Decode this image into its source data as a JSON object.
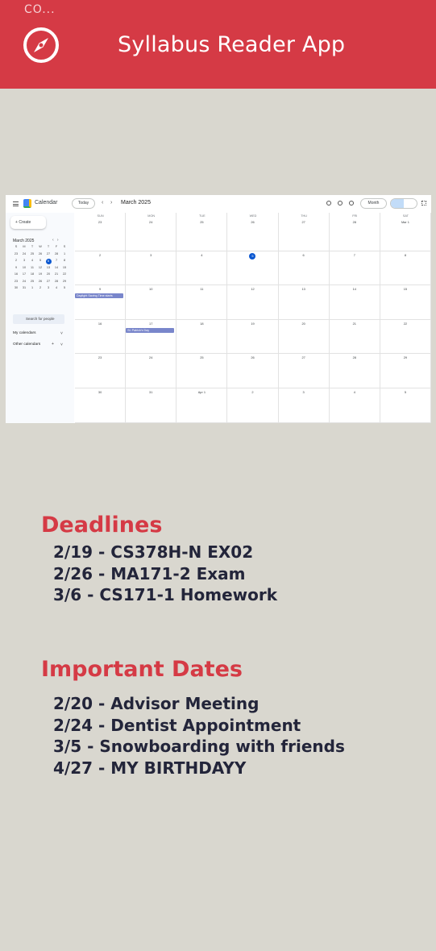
{
  "status_bar": {
    "text": "CO..."
  },
  "app_bar": {
    "title": "Syllabus Reader App",
    "icon": "compass-icon",
    "color": "#d53a45"
  },
  "calendar_screenshot": {
    "app_name": "Calendar",
    "today_button": "Today",
    "month_title": "March 2025",
    "view_select": "Month",
    "create_button": "Create",
    "mini_calendar": {
      "title": "March 2025",
      "weekday_letters": [
        "S",
        "M",
        "T",
        "W",
        "T",
        "F",
        "S"
      ],
      "days": [
        "23",
        "24",
        "25",
        "26",
        "27",
        "28",
        "1",
        "2",
        "3",
        "4",
        "5",
        "6",
        "7",
        "8",
        "9",
        "10",
        "11",
        "12",
        "13",
        "14",
        "15",
        "16",
        "17",
        "18",
        "19",
        "20",
        "21",
        "22",
        "23",
        "24",
        "25",
        "26",
        "27",
        "28",
        "29",
        "30",
        "31",
        "1",
        "2",
        "3",
        "4",
        "5"
      ],
      "selected": "5"
    },
    "search_people": "Search for people",
    "my_calendars": "My calendars",
    "other_calendars": "Other calendars",
    "weekdays": [
      "SUN",
      "MON",
      "TUE",
      "WED",
      "THU",
      "FRI",
      "SAT"
    ],
    "weeks": [
      [
        "23",
        "24",
        "25",
        "26",
        "27",
        "28",
        "Mar 1"
      ],
      [
        "2",
        "3",
        "4",
        "5",
        "6",
        "7",
        "8"
      ],
      [
        "9",
        "10",
        "11",
        "12",
        "13",
        "14",
        "15"
      ],
      [
        "16",
        "17",
        "18",
        "19",
        "20",
        "21",
        "22"
      ],
      [
        "23",
        "24",
        "25",
        "26",
        "27",
        "28",
        "29"
      ],
      [
        "30",
        "31",
        "Apr 1",
        "2",
        "3",
        "4",
        "5"
      ]
    ],
    "today_date": "5",
    "events": [
      {
        "title": "Daylight Saving Time starts",
        "week": 2,
        "day": 0
      },
      {
        "title": "St. Patrick's Day",
        "week": 3,
        "day": 1
      }
    ]
  },
  "deadlines": {
    "heading": "Deadlines",
    "items": [
      "2/19 - CS378H-N EX02",
      "2/26 - MA171-2 Exam",
      "3/6 - CS171-1 Homework"
    ]
  },
  "important_dates": {
    "heading": "Important Dates",
    "items": [
      "2/20 - Advisor Meeting",
      "2/24 - Dentist Appointment",
      "3/5 - Snowboarding with friends",
      "4/27 - MY BIRTHDAYY"
    ]
  },
  "colors": {
    "accent": "#d53a45",
    "background": "#d9d7cf",
    "text": "#23253a"
  }
}
